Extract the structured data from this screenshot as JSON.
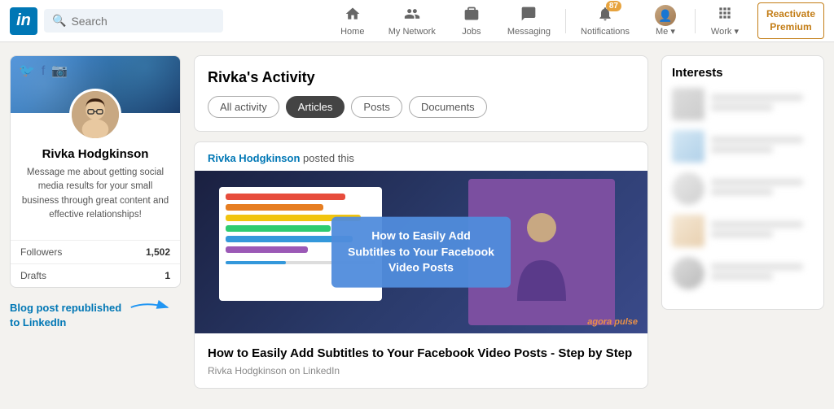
{
  "navbar": {
    "logo_text": "in",
    "search_placeholder": "Search",
    "nav_items": [
      {
        "id": "home",
        "label": "Home",
        "icon": "🏠",
        "badge": null
      },
      {
        "id": "network",
        "label": "My Network",
        "icon": "👥",
        "badge": null
      },
      {
        "id": "jobs",
        "label": "Jobs",
        "icon": "💼",
        "badge": null
      },
      {
        "id": "messaging",
        "label": "Messaging",
        "icon": "💬",
        "badge": null
      },
      {
        "id": "notifications",
        "label": "Notifications",
        "icon": "🔔",
        "badge": "87"
      },
      {
        "id": "me",
        "label": "Me",
        "icon": "person",
        "badge": null
      },
      {
        "id": "work",
        "label": "Work",
        "icon": "grid",
        "badge": null
      }
    ],
    "reactivate_line1": "Reactivate",
    "reactivate_line2": "Premium"
  },
  "profile": {
    "name": "Rivka Hodgkinson",
    "bio": "Message me about getting social media results for your small business through great content and effective relationships!",
    "followers_label": "Followers",
    "followers_count": "1,502",
    "drafts_label": "Drafts",
    "drafts_count": "1"
  },
  "blog_link": {
    "line1": "Blog post republished",
    "line2": "to LinkedIn"
  },
  "activity": {
    "title": "Rivka's Activity",
    "tabs": [
      {
        "id": "all",
        "label": "All activity",
        "active": false
      },
      {
        "id": "articles",
        "label": "Articles",
        "active": true
      },
      {
        "id": "posts",
        "label": "Posts",
        "active": false
      },
      {
        "id": "documents",
        "label": "Documents",
        "active": false
      }
    ]
  },
  "post": {
    "meta_name": "Rivka Hodgkinson",
    "meta_action": "posted this",
    "image_overlay_text": "How to Easily Add Subtitles to Your Facebook Video Posts",
    "agora_label": "agora pulse",
    "title": "How to Easily Add Subtitles to Your Facebook Video Posts - Step by Step",
    "source": "Rivka Hodgkinson on LinkedIn"
  },
  "interests": {
    "title": "Interests"
  }
}
